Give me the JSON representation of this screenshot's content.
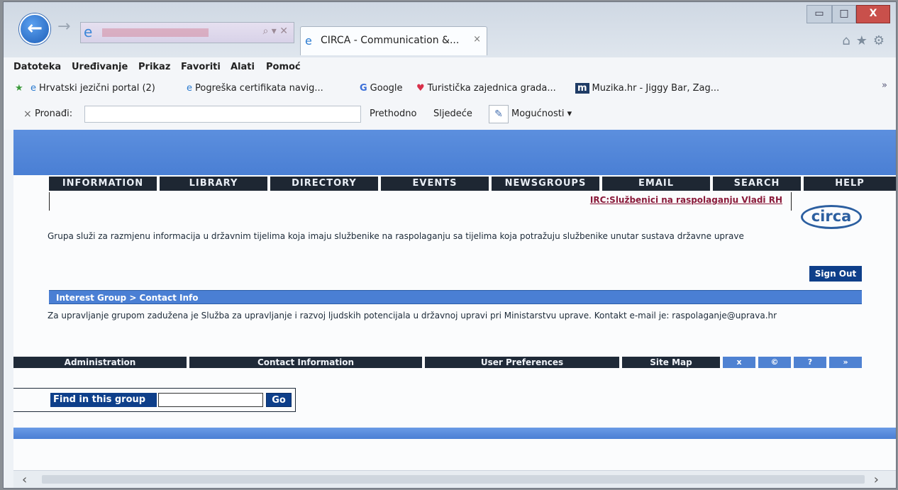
{
  "browser": {
    "tab_title": "CIRCA - Communication &...",
    "tab_close": "×",
    "back_glyph": "←",
    "forward_glyph": "→",
    "window_min": "▭",
    "window_max": "□",
    "window_close": "X",
    "toolbar_icons": [
      "home-icon",
      "star-icon",
      "gear-icon"
    ]
  },
  "menu": [
    "Datoteka",
    "Uređivanje",
    "Prikaz",
    "Favoriti",
    "Alati",
    "Pomoć"
  ],
  "favorites": [
    {
      "label": "Hrvatski jezični portal (2)",
      "icon": "e"
    },
    {
      "label": "Pogreška certifikata navig...",
      "icon": "e"
    },
    {
      "label": "Google",
      "icon": "G"
    },
    {
      "label": "Turistička zajednica grada...",
      "icon": "♥"
    },
    {
      "label": "Muzika.hr - Jiggy Bar, Zag...",
      "icon": "m"
    }
  ],
  "favorites_more": "»",
  "findbar": {
    "close": "×",
    "label": "Pronađi:",
    "value": "",
    "prev": "Prethodno",
    "next": "Sljedeće",
    "options": "Mogućnosti"
  },
  "site": {
    "nav": [
      "INFORMATION",
      "LIBRARY",
      "DIRECTORY",
      "EVENTS",
      "NEWSGROUPS",
      "EMAIL",
      "SEARCH",
      "HELP"
    ],
    "irc_link": "IRC:Službenici na raspolaganju Vladi RH",
    "logo": "circa",
    "description": "Grupa služi za razmjenu informacija u državnim tijelima koja imaju službenike na raspolaganju sa tijelima koja potražuju službenike unutar sustava državne uprave",
    "sign_out": "Sign Out",
    "breadcrumb": "Interest Group > Contact Info",
    "contact_text": "Za upravljanje grupom zadužena je Služba za upravljanje i razvoj ljudskih potencijala u državnoj upravi pri Ministarstvu uprave. Kontakt e-mail je: raspolaganje@uprava.hr",
    "footer": [
      "Administration",
      "Contact Information",
      "User Preferences",
      "Site Map"
    ],
    "footer_buttons": [
      "x",
      "©",
      "?",
      "»"
    ],
    "find_label": "Find in this group",
    "find_value": "",
    "go": "Go"
  },
  "scroll": {
    "left": "‹",
    "right": "›"
  }
}
